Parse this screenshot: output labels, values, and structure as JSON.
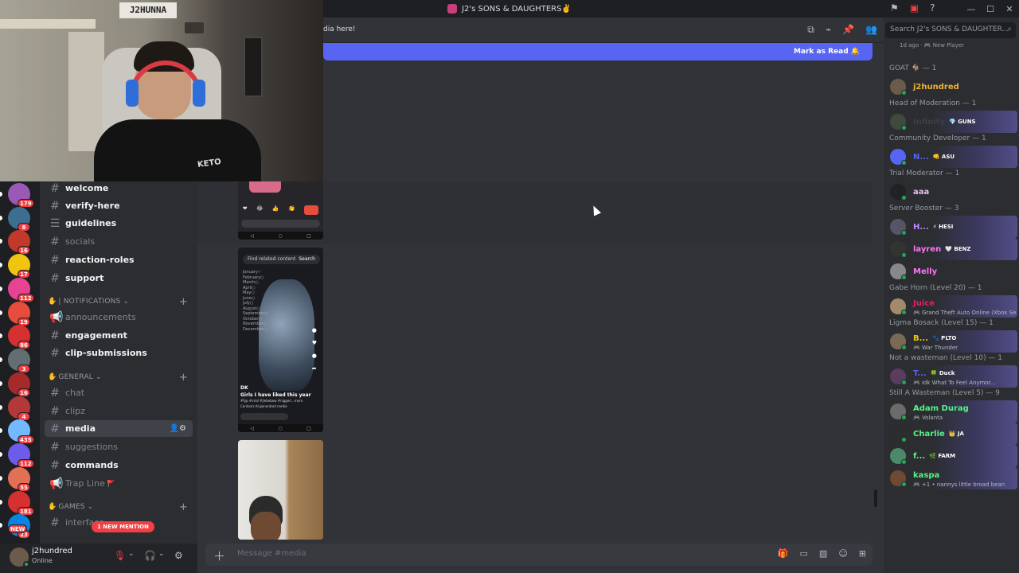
{
  "titlebar": {
    "server_name": "J2's SONS & DAUGHTERS✌️"
  },
  "webcam": {
    "nameplate": "J2HUNNA",
    "shirt_text": "KETO"
  },
  "guilds": [
    {
      "badge": "179",
      "color": "#9b59b6"
    },
    {
      "badge": "8",
      "color": "#3b6e8f"
    },
    {
      "badge": "16",
      "color": "#c0392b"
    },
    {
      "badge": "17",
      "color": "#f1c40f"
    },
    {
      "badge": "112",
      "color": "#e84393"
    },
    {
      "badge": "19",
      "color": "#e74c3c"
    },
    {
      "badge": "86",
      "color": "#d63031"
    },
    {
      "badge": "3",
      "color": "#636e72"
    },
    {
      "badge": "16",
      "color": "#a52a2a"
    },
    {
      "badge": "4",
      "color": "#b33939"
    },
    {
      "badge": "435",
      "color": "#74b9ff"
    },
    {
      "badge": "112",
      "color": "#6c5ce7"
    },
    {
      "badge": "55",
      "color": "#e17055"
    },
    {
      "badge": "181",
      "color": "#d63031"
    },
    {
      "badge": "23",
      "color": "#0984e3"
    }
  ],
  "guild_new_label": "NEW",
  "channels": {
    "welcome": "welcome",
    "verify": "verify-here",
    "guidelines": "guidelines",
    "socials": "socials",
    "reaction_roles": "reaction-roles",
    "support": "support",
    "cat_notifications": "| NOTIFICATIONS",
    "announcements": "announcements",
    "engagement": "engagement",
    "clip_submissions": "clip-submissions",
    "cat_general": "GENERAL",
    "chat": "chat",
    "clipz": "clipz",
    "media": "media",
    "suggestions": "suggestions",
    "commands": "commands",
    "trap_line": "Trap Line",
    "cat_games": "GAMES",
    "interface": "interface"
  },
  "mention_pill": "1 NEW MENTION",
  "user": {
    "name": "j2hundred",
    "status": "Online"
  },
  "header": {
    "topic_snippet": "dia here!"
  },
  "new_messages_bar": {
    "action": "Mark as Read"
  },
  "media_cards": {
    "card2_search": "Find related content",
    "card2_search_btn": "Search",
    "card2_caption_user": "DK",
    "card2_caption_title": "Girls I have liked this year",
    "card2_caption_tags": "#fyp #viral #jlebebow #niggeri...more",
    "card2_caption_note": "Contains AI-generated media"
  },
  "composer": {
    "placeholder": "Message #media"
  },
  "search": {
    "placeholder": "Search J2's SONS & DAUGHTER..."
  },
  "members": {
    "top_partial": {
      "time": "1d ago",
      "role": "New Player"
    },
    "groups": [
      {
        "header": "GOAT 🐐 — 1",
        "items": [
          {
            "name": "j2hundred",
            "color": "#f0b232",
            "tag": "",
            "activity": ""
          }
        ]
      },
      {
        "header": "Head of Moderation — 1",
        "items": [
          {
            "name": "Infinity",
            "color": "#3c3f45",
            "tag": "💎 GUNS",
            "activity": ""
          }
        ]
      },
      {
        "header": "Community Developer — 1",
        "items": [
          {
            "name": "N...",
            "color": "#5865f2",
            "tag": "👊 ASU",
            "activity": ""
          }
        ]
      },
      {
        "header": "Trial Moderator — 1",
        "items": [
          {
            "name": "aaa",
            "color": "#e8bdf0",
            "tag": "",
            "activity": ""
          }
        ]
      },
      {
        "header": "Server Booster — 3",
        "items": [
          {
            "name": "H...",
            "color": "#c389ff",
            "tag": "⚡ HESI",
            "activity": ""
          },
          {
            "name": "layren",
            "color": "#ff73fa",
            "tag": "🤍 BENZ",
            "activity": ""
          },
          {
            "name": "Melly",
            "color": "#ff73fa",
            "tag": "",
            "activity": ""
          }
        ]
      },
      {
        "header": "Gabe Horn (Level 20) — 1",
        "items": [
          {
            "name": "Juice",
            "color": "#e91e63",
            "tag": "",
            "activity": "Grand Theft Auto Online (Xbox Se"
          }
        ]
      },
      {
        "header": "Ligma Bosack (Level 15) — 1",
        "items": [
          {
            "name": "B...",
            "color": "#f1c40f",
            "tag": "🐾 PLTO",
            "activity": "War Thunder"
          }
        ]
      },
      {
        "header": "Not a wasteman (Level 10) — 1",
        "items": [
          {
            "name": "T...",
            "color": "#5865f2",
            "tag": "🍀 Duck",
            "activity": "idk What To Feel Anymor..."
          }
        ]
      },
      {
        "header": "Still A Wasteman (Level 5) — 9",
        "items": [
          {
            "name": "Adam Durag",
            "color": "#57f287",
            "tag": "",
            "activity": "Volanta"
          },
          {
            "name": "Charlie",
            "color": "#57f287",
            "tag": "👑 JA",
            "activity": ""
          },
          {
            "name": "f...",
            "color": "#57f287",
            "tag": "🌿 FARM",
            "activity": ""
          },
          {
            "name": "kaspa",
            "color": "#57f287",
            "tag": "",
            "activity": "+1 • nannys little broad bean"
          }
        ]
      }
    ]
  }
}
